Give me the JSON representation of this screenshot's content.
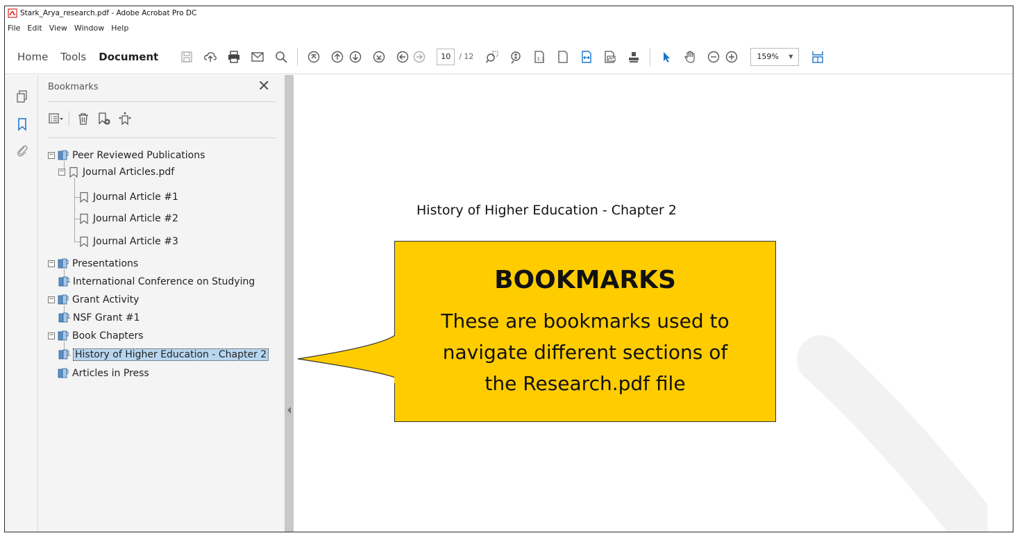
{
  "window": {
    "title": "Stark_Arya_research.pdf - Adobe Acrobat Pro DC",
    "menu": [
      "File",
      "Edit",
      "View",
      "Window",
      "Help"
    ]
  },
  "toolbar": {
    "tabs": [
      "Home",
      "Tools",
      "Document"
    ],
    "active_tab": "Document",
    "current_page": "10",
    "page_total": "/ 12",
    "zoom": "159%"
  },
  "bookmarks_panel": {
    "title": "Bookmarks",
    "items": [
      {
        "label": "Peer Reviewed Publications",
        "level": 0,
        "expanded": true,
        "icon": "bookmark-folder-icon"
      },
      {
        "label": "Journal Articles.pdf",
        "level": 1,
        "expanded": true,
        "icon": "bookmark-icon"
      },
      {
        "label": "Journal Article #1",
        "level": 2,
        "icon": "bookmark-icon"
      },
      {
        "label": "Journal Article #2",
        "level": 2,
        "icon": "bookmark-icon"
      },
      {
        "label": "Journal Article #3",
        "level": 2,
        "icon": "bookmark-icon"
      },
      {
        "label": "Presentations",
        "level": 0,
        "expanded": true,
        "icon": "bookmark-folder-icon"
      },
      {
        "label": "International Conference on Studying",
        "level": 1,
        "icon": "bookmark-folder-icon"
      },
      {
        "label": "Grant Activity",
        "level": 0,
        "expanded": true,
        "icon": "bookmark-folder-icon"
      },
      {
        "label": "NSF Grant #1",
        "level": 1,
        "icon": "bookmark-folder-icon"
      },
      {
        "label": "Book Chapters",
        "level": 0,
        "expanded": true,
        "icon": "bookmark-folder-icon"
      },
      {
        "label": "History of Higher Education - Chapter 2",
        "level": 1,
        "selected": true,
        "icon": "bookmark-folder-icon"
      },
      {
        "label": "Articles in Press",
        "level": 0,
        "icon": "bookmark-folder-icon"
      }
    ]
  },
  "document": {
    "heading": "History of Higher Education - Chapter 2"
  },
  "callout": {
    "title": "BOOKMARKS",
    "lines": [
      "These are bookmarks used to",
      "navigate different sections of",
      "the Research.pdf file"
    ]
  },
  "colors": {
    "callout_fill": "#ffcc00",
    "accent_blue": "#1a73c9",
    "selection": "#b8d6ef"
  }
}
